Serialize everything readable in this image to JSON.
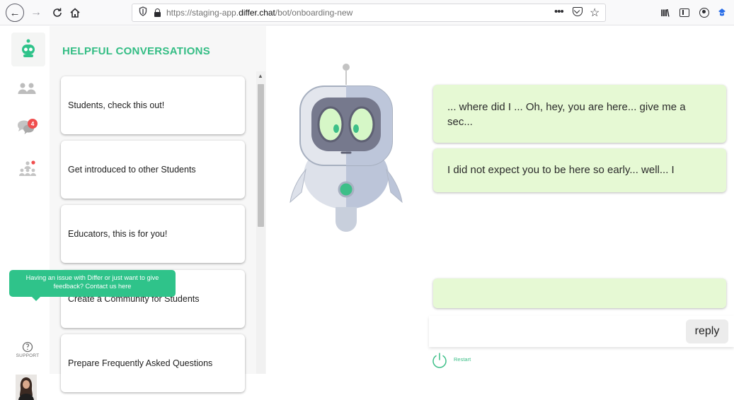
{
  "browser": {
    "url_prefix": "https://staging-app.",
    "url_domain": "differ.chat",
    "url_path": "/bot/onboarding-new",
    "icons": {
      "back": "back-arrow-icon",
      "forward": "forward-arrow-icon",
      "reload": "reload-icon",
      "home": "home-icon",
      "shield": "tracking-shield-icon",
      "lock": "lock-icon",
      "more": "more-actions-icon",
      "pocket": "pocket-icon",
      "bookmark": "bookmark-star-icon",
      "library": "library-icon",
      "sidebar": "sidebar-icon",
      "account": "account-icon",
      "extension": "extension-icon"
    },
    "more_glyph": "•••",
    "library_glyph": "III\\"
  },
  "rail": {
    "items": [
      {
        "name": "robot-logo-icon"
      },
      {
        "name": "people-icon"
      },
      {
        "name": "chat-bubbles-icon",
        "badge": "4"
      },
      {
        "name": "community-icon"
      }
    ],
    "support_tooltip": "Having an issue with Differ or just want to give feedback? Contact us here",
    "support_label": "SUPPORT",
    "accent_color": "#2fc38a"
  },
  "panel": {
    "title": "HELPFUL CONVERSATIONS",
    "items": [
      {
        "label": "Students, check this out!"
      },
      {
        "label": "Get introduced to other Students"
      },
      {
        "label": "Educators, this is for you!"
      },
      {
        "label": "Create a Community for Students"
      },
      {
        "label": "Prepare Frequently Asked Questions"
      }
    ]
  },
  "chat": {
    "messages": [
      {
        "text": "... where did I ... Oh, hey, you are here... give me a sec..."
      },
      {
        "text": "I did not expect you to be here so early... well... I"
      },
      {
        "text": ""
      }
    ],
    "input": {
      "value": "",
      "placeholder": ""
    },
    "reply_label": "reply",
    "restart_label": "Restart",
    "bubble_color": "#e6f9d4"
  }
}
